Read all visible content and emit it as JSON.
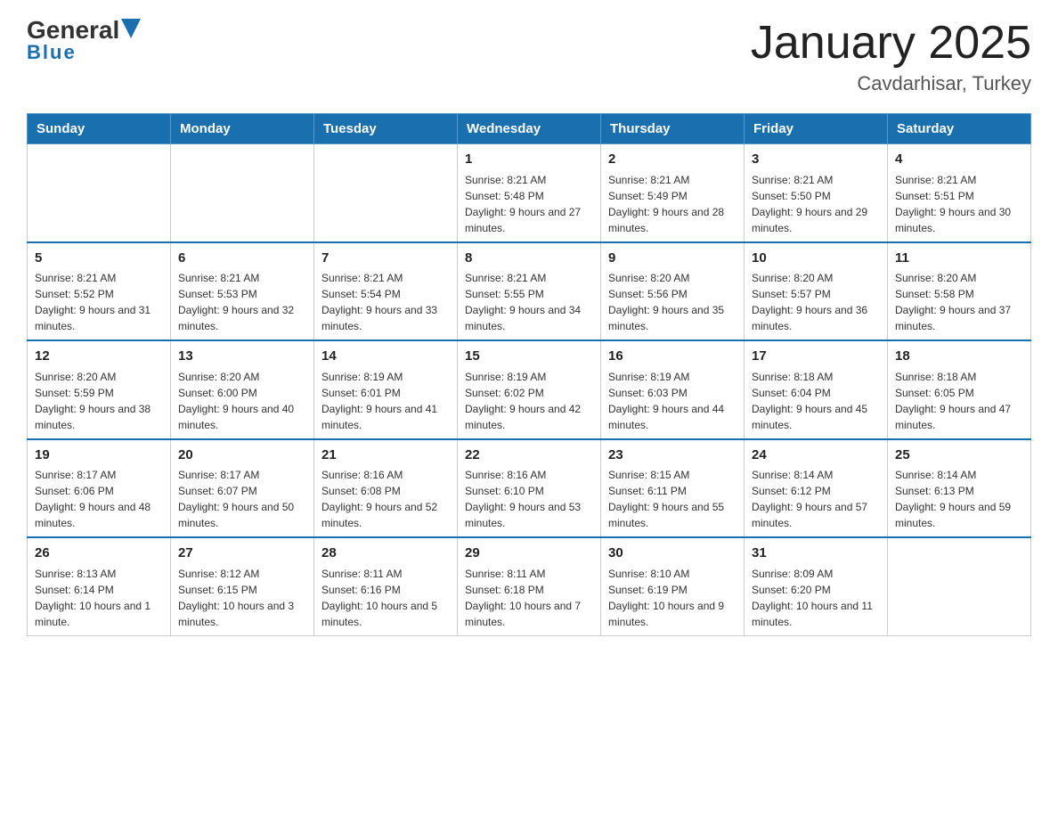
{
  "header": {
    "logo_general": "General",
    "logo_blue": "Blue",
    "title": "January 2025",
    "subtitle": "Cavdarhisar, Turkey"
  },
  "calendar": {
    "days_of_week": [
      "Sunday",
      "Monday",
      "Tuesday",
      "Wednesday",
      "Thursday",
      "Friday",
      "Saturday"
    ],
    "weeks": [
      [
        {
          "day": "",
          "info": ""
        },
        {
          "day": "",
          "info": ""
        },
        {
          "day": "",
          "info": ""
        },
        {
          "day": "1",
          "info": "Sunrise: 8:21 AM\nSunset: 5:48 PM\nDaylight: 9 hours and 27 minutes."
        },
        {
          "day": "2",
          "info": "Sunrise: 8:21 AM\nSunset: 5:49 PM\nDaylight: 9 hours and 28 minutes."
        },
        {
          "day": "3",
          "info": "Sunrise: 8:21 AM\nSunset: 5:50 PM\nDaylight: 9 hours and 29 minutes."
        },
        {
          "day": "4",
          "info": "Sunrise: 8:21 AM\nSunset: 5:51 PM\nDaylight: 9 hours and 30 minutes."
        }
      ],
      [
        {
          "day": "5",
          "info": "Sunrise: 8:21 AM\nSunset: 5:52 PM\nDaylight: 9 hours and 31 minutes."
        },
        {
          "day": "6",
          "info": "Sunrise: 8:21 AM\nSunset: 5:53 PM\nDaylight: 9 hours and 32 minutes."
        },
        {
          "day": "7",
          "info": "Sunrise: 8:21 AM\nSunset: 5:54 PM\nDaylight: 9 hours and 33 minutes."
        },
        {
          "day": "8",
          "info": "Sunrise: 8:21 AM\nSunset: 5:55 PM\nDaylight: 9 hours and 34 minutes."
        },
        {
          "day": "9",
          "info": "Sunrise: 8:20 AM\nSunset: 5:56 PM\nDaylight: 9 hours and 35 minutes."
        },
        {
          "day": "10",
          "info": "Sunrise: 8:20 AM\nSunset: 5:57 PM\nDaylight: 9 hours and 36 minutes."
        },
        {
          "day": "11",
          "info": "Sunrise: 8:20 AM\nSunset: 5:58 PM\nDaylight: 9 hours and 37 minutes."
        }
      ],
      [
        {
          "day": "12",
          "info": "Sunrise: 8:20 AM\nSunset: 5:59 PM\nDaylight: 9 hours and 38 minutes."
        },
        {
          "day": "13",
          "info": "Sunrise: 8:20 AM\nSunset: 6:00 PM\nDaylight: 9 hours and 40 minutes."
        },
        {
          "day": "14",
          "info": "Sunrise: 8:19 AM\nSunset: 6:01 PM\nDaylight: 9 hours and 41 minutes."
        },
        {
          "day": "15",
          "info": "Sunrise: 8:19 AM\nSunset: 6:02 PM\nDaylight: 9 hours and 42 minutes."
        },
        {
          "day": "16",
          "info": "Sunrise: 8:19 AM\nSunset: 6:03 PM\nDaylight: 9 hours and 44 minutes."
        },
        {
          "day": "17",
          "info": "Sunrise: 8:18 AM\nSunset: 6:04 PM\nDaylight: 9 hours and 45 minutes."
        },
        {
          "day": "18",
          "info": "Sunrise: 8:18 AM\nSunset: 6:05 PM\nDaylight: 9 hours and 47 minutes."
        }
      ],
      [
        {
          "day": "19",
          "info": "Sunrise: 8:17 AM\nSunset: 6:06 PM\nDaylight: 9 hours and 48 minutes."
        },
        {
          "day": "20",
          "info": "Sunrise: 8:17 AM\nSunset: 6:07 PM\nDaylight: 9 hours and 50 minutes."
        },
        {
          "day": "21",
          "info": "Sunrise: 8:16 AM\nSunset: 6:08 PM\nDaylight: 9 hours and 52 minutes."
        },
        {
          "day": "22",
          "info": "Sunrise: 8:16 AM\nSunset: 6:10 PM\nDaylight: 9 hours and 53 minutes."
        },
        {
          "day": "23",
          "info": "Sunrise: 8:15 AM\nSunset: 6:11 PM\nDaylight: 9 hours and 55 minutes."
        },
        {
          "day": "24",
          "info": "Sunrise: 8:14 AM\nSunset: 6:12 PM\nDaylight: 9 hours and 57 minutes."
        },
        {
          "day": "25",
          "info": "Sunrise: 8:14 AM\nSunset: 6:13 PM\nDaylight: 9 hours and 59 minutes."
        }
      ],
      [
        {
          "day": "26",
          "info": "Sunrise: 8:13 AM\nSunset: 6:14 PM\nDaylight: 10 hours and 1 minute."
        },
        {
          "day": "27",
          "info": "Sunrise: 8:12 AM\nSunset: 6:15 PM\nDaylight: 10 hours and 3 minutes."
        },
        {
          "day": "28",
          "info": "Sunrise: 8:11 AM\nSunset: 6:16 PM\nDaylight: 10 hours and 5 minutes."
        },
        {
          "day": "29",
          "info": "Sunrise: 8:11 AM\nSunset: 6:18 PM\nDaylight: 10 hours and 7 minutes."
        },
        {
          "day": "30",
          "info": "Sunrise: 8:10 AM\nSunset: 6:19 PM\nDaylight: 10 hours and 9 minutes."
        },
        {
          "day": "31",
          "info": "Sunrise: 8:09 AM\nSunset: 6:20 PM\nDaylight: 10 hours and 11 minutes."
        },
        {
          "day": "",
          "info": ""
        }
      ]
    ]
  }
}
